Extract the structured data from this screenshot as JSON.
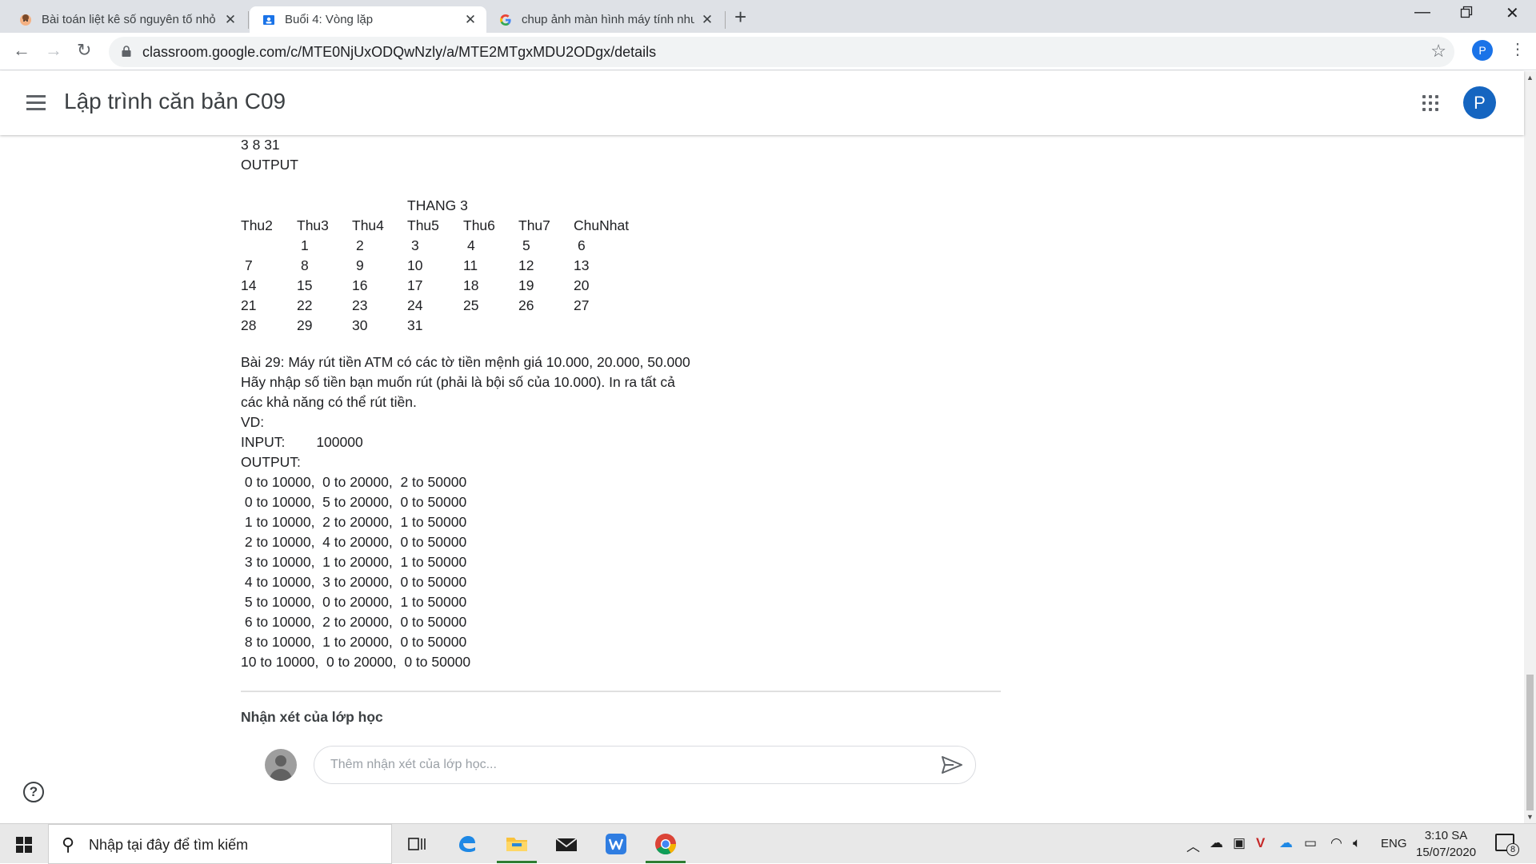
{
  "browser": {
    "tabs": [
      {
        "title": "Bài toán liệt kê số nguyên tố nhỏ",
        "active": false
      },
      {
        "title": "Buổi 4: Vòng lặp",
        "active": true
      },
      {
        "title": "chup ảnh màn hình máy tính như",
        "active": false
      }
    ],
    "url": "classroom.google.com/c/MTE0NjUxODQwNzly/a/MTE2MTgxMDU2ODgx/details",
    "profile_letter": "P"
  },
  "app": {
    "title": "Lập trình căn bản C09",
    "avatar_letter": "P"
  },
  "content": {
    "input_line": "3 8 31",
    "output_label": "OUTPUT",
    "calendar": {
      "title": "THANG 3",
      "days": [
        "Thu2",
        "Thu3",
        "Thu4",
        "Thu5",
        "Thu6",
        "Thu7",
        "ChuNhat"
      ],
      "rows": [
        [
          "",
          "1",
          "2",
          "3",
          "4",
          "5",
          "6"
        ],
        [
          "7",
          "8",
          "9",
          "10",
          "11",
          "12",
          "13"
        ],
        [
          "14",
          "15",
          "16",
          "17",
          "18",
          "19",
          "20"
        ],
        [
          "21",
          "22",
          "23",
          "24",
          "25",
          "26",
          "27"
        ],
        [
          "28",
          "29",
          "30",
          "31",
          "",
          "",
          ""
        ]
      ]
    },
    "exercise_lines": [
      "Bài 29: Máy rút tiền ATM có các tờ tiền mệnh giá 10.000, 20.000, 50.000",
      "Hãy nhập số tiền bạn muốn rút (phải là bội số của 10.000). In ra tất cả",
      "các khả năng có thể rút tiền.",
      "VD:",
      "INPUT:        100000",
      "OUTPUT:",
      " 0 to 10000,  0 to 20000,  2 to 50000",
      " 0 to 10000,  5 to 20000,  0 to 50000",
      " 1 to 10000,  2 to 20000,  1 to 50000",
      " 2 to 10000,  4 to 20000,  0 to 50000",
      " 3 to 10000,  1 to 20000,  1 to 50000",
      " 4 to 10000,  3 to 20000,  0 to 50000",
      " 5 to 10000,  0 to 20000,  1 to 50000",
      " 6 to 10000,  2 to 20000,  0 to 50000",
      " 8 to 10000,  1 to 20000,  0 to 50000",
      "10 to 10000,  0 to 20000,  0 to 50000"
    ],
    "comments_title": "Nhận xét của lớp học",
    "comment_placeholder": "Thêm nhận xét của lớp học..."
  },
  "taskbar": {
    "search_placeholder": "Nhập tại đây để tìm kiếm",
    "language": "ENG",
    "time": "3:10 SA",
    "date": "15/07/2020",
    "notification_count": "8"
  }
}
